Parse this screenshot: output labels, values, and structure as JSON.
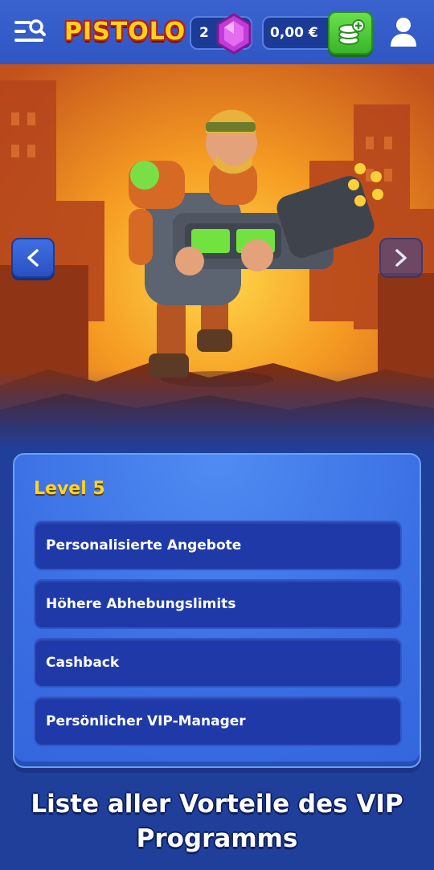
{
  "header": {
    "logo_text": "PISTOLO",
    "gems": "2",
    "balance": "0,00 €"
  },
  "icons": {
    "menu": "menu-search-icon",
    "gem": "gem-icon",
    "deposit": "coins-plus-icon",
    "profile": "user-icon",
    "prev": "chevron-left-icon",
    "next": "chevron-right-icon"
  },
  "vip": {
    "level": "Level 5",
    "benefits": [
      "Personalisierte Angebote",
      "Höhere Abhebungslimits",
      "Cashback",
      "Persönlicher VIP-Manager"
    ]
  },
  "footer": {
    "line1": "Liste aller Vorteile des VIP",
    "line2": "Programms"
  },
  "colors": {
    "accent_blue": "#3a6ee3",
    "header_blue": "#3b63cf",
    "level_yellow": "#ffd525",
    "deposit_green": "#38b52a",
    "gem_purple": "#c23bd8"
  }
}
